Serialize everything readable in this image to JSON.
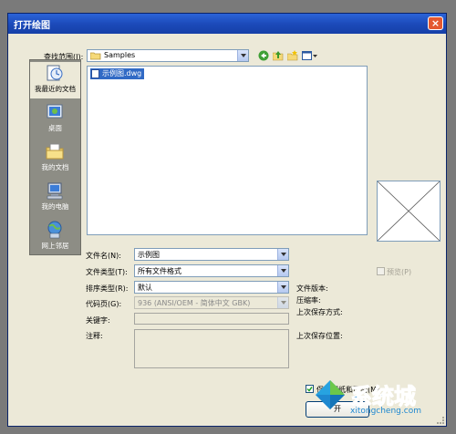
{
  "window": {
    "title": "打开绘图",
    "close_glyph": "×"
  },
  "lookin": {
    "label": "查找范围(I):",
    "value": "Samples"
  },
  "toolbar": {
    "back_icon": "back-arrow-icon",
    "up_icon": "up-folder-icon",
    "newfolder_icon": "new-folder-icon",
    "views_icon": "views-menu-icon"
  },
  "places": [
    {
      "label": "我最近的文档",
      "icon": "recent-docs-icon"
    },
    {
      "label": "桌面",
      "icon": "desktop-icon"
    },
    {
      "label": "我的文档",
      "icon": "my-documents-icon"
    },
    {
      "label": "我的电脑",
      "icon": "my-computer-icon"
    },
    {
      "label": "网上邻居",
      "icon": "network-places-icon"
    }
  ],
  "files": [
    {
      "name": "示例图.dwg",
      "icon": "dwg-file-icon"
    }
  ],
  "form": {
    "filename_label": "文件名(N):",
    "filename_value": "示例图",
    "filetype_label": "文件类型(T):",
    "filetype_value": "所有文件格式",
    "sort_label": "排序类型(R):",
    "sort_value": "默认",
    "codepage_label": "代码页(G):",
    "codepage_value": "936 (ANSI/OEM - 简体中文 GBK)",
    "keywords_label": "关键字:",
    "comments_label": "注释:"
  },
  "info": {
    "version_label": "文件版本:",
    "ratio_label": "压缩率:",
    "lastsave_method_label": "上次保存方式:",
    "lastsave_location_label": "上次保存位置:"
  },
  "preview": {
    "checkbox_label": "预览(P)"
  },
  "keep_checkbox": {
    "label": "保持图纸和页面(M)",
    "checked": true
  },
  "buttons": {
    "open": "开"
  },
  "watermark": {
    "brand": "系统城",
    "url": "xitongcheng.com"
  },
  "colors": {
    "title_bar": "#1b49b8",
    "selection": "#316ac5",
    "dialog_bg": "#ece9d8"
  }
}
